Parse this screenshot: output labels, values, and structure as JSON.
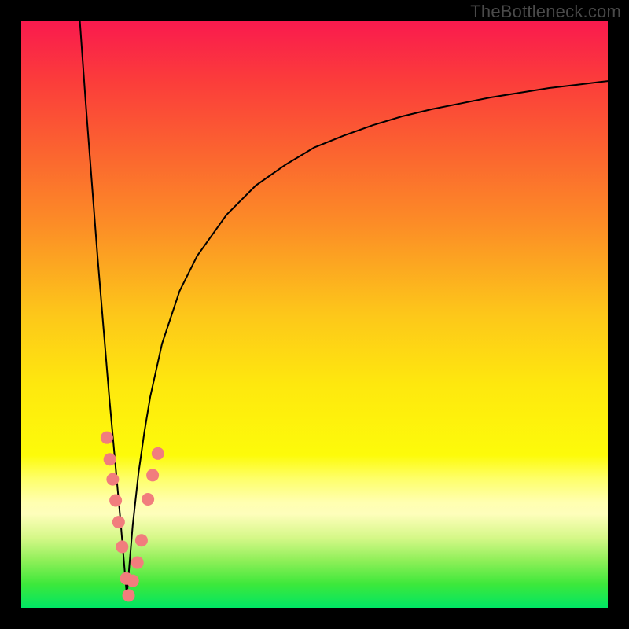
{
  "watermark": "TheBottleneck.com",
  "frame": {
    "outer_w": 800,
    "outer_h": 800,
    "inner_left": 27,
    "inner_top": 27,
    "inner_w": 746,
    "inner_h": 746,
    "border_color": "#000000"
  },
  "gradient": {
    "stops": [
      {
        "pct": 0,
        "color": "#fa1a4e"
      },
      {
        "pct": 10,
        "color": "#fb3c3b"
      },
      {
        "pct": 22,
        "color": "#fb6330"
      },
      {
        "pct": 35,
        "color": "#fc8e26"
      },
      {
        "pct": 50,
        "color": "#fdc71a"
      },
      {
        "pct": 62,
        "color": "#fee80e"
      },
      {
        "pct": 74,
        "color": "#fdfb0a"
      },
      {
        "pct": 78,
        "color": "#feff6a"
      },
      {
        "pct": 82,
        "color": "#ffffb0"
      },
      {
        "pct": 84,
        "color": "#fefebb"
      },
      {
        "pct": 88,
        "color": "#d6f889"
      },
      {
        "pct": 92,
        "color": "#8eef58"
      },
      {
        "pct": 96,
        "color": "#3de83b"
      },
      {
        "pct": 100,
        "color": "#00e664"
      }
    ]
  },
  "chart_data": {
    "type": "line",
    "title": "",
    "xlabel": "",
    "ylabel": "",
    "xlim": [
      0,
      100
    ],
    "ylim": [
      0,
      100
    ],
    "notes": "V-shaped bottleneck curve over vertical heat gradient background. Vertex near x≈18. Left branch steep; right branch asymptotic toward y≈90. Pink dotted markers cluster near the vertex.",
    "series": [
      {
        "name": "curve",
        "stroke": "#000000",
        "stroke_width": 2,
        "x": [
          10,
          11,
          12,
          13,
          14,
          15,
          16,
          17,
          17.5,
          18,
          18.5,
          19,
          20,
          21,
          22,
          24,
          27,
          30,
          35,
          40,
          45,
          50,
          55,
          60,
          65,
          70,
          75,
          80,
          85,
          90,
          95,
          100
        ],
        "y": [
          100,
          86,
          73,
          60,
          48,
          36,
          25,
          14,
          8,
          2,
          8,
          14,
          23,
          30,
          36,
          45,
          54,
          60,
          67,
          72,
          75.5,
          78.5,
          80.5,
          82.3,
          83.8,
          85,
          86,
          87,
          87.8,
          88.6,
          89.2,
          89.8
        ]
      }
    ],
    "markers": {
      "name": "threshold-dots",
      "color": "#f17d7d",
      "radius_px": 8,
      "points": [
        {
          "x": 14.6,
          "y": 29.0
        },
        {
          "x": 15.1,
          "y": 25.3
        },
        {
          "x": 15.6,
          "y": 21.9
        },
        {
          "x": 16.1,
          "y": 18.3
        },
        {
          "x": 16.6,
          "y": 14.6
        },
        {
          "x": 17.2,
          "y": 10.4
        },
        {
          "x": 17.9,
          "y": 5.0
        },
        {
          "x": 18.3,
          "y": 2.1
        },
        {
          "x": 19.0,
          "y": 4.6
        },
        {
          "x": 19.8,
          "y": 7.7
        },
        {
          "x": 20.5,
          "y": 11.5
        },
        {
          "x": 21.6,
          "y": 18.5
        },
        {
          "x": 22.4,
          "y": 22.6
        },
        {
          "x": 23.3,
          "y": 26.3
        }
      ]
    }
  }
}
